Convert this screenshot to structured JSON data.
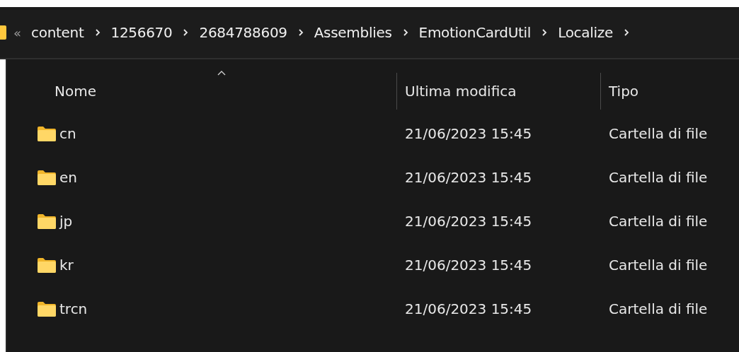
{
  "address_bar": {
    "overflow": "«",
    "path": [
      {
        "label": "content"
      },
      {
        "label": "1256670"
      },
      {
        "label": "2684788609"
      },
      {
        "label": "Assemblies"
      },
      {
        "label": "EmotionCardUtil"
      },
      {
        "label": "Localize"
      }
    ]
  },
  "table": {
    "columns": [
      {
        "label": "Nome",
        "sorted": true
      },
      {
        "label": "Ultima modifica",
        "sorted": false
      },
      {
        "label": "Tipo",
        "sorted": false
      }
    ],
    "rows": [
      {
        "name": "cn",
        "modified": "21/06/2023 15:45",
        "type": "Cartella di file"
      },
      {
        "name": "en",
        "modified": "21/06/2023 15:45",
        "type": "Cartella di file"
      },
      {
        "name": "jp",
        "modified": "21/06/2023 15:45",
        "type": "Cartella di file"
      },
      {
        "name": "kr",
        "modified": "21/06/2023 15:45",
        "type": "Cartella di file"
      },
      {
        "name": "trcn",
        "modified": "21/06/2023 15:45",
        "type": "Cartella di file"
      }
    ]
  }
}
